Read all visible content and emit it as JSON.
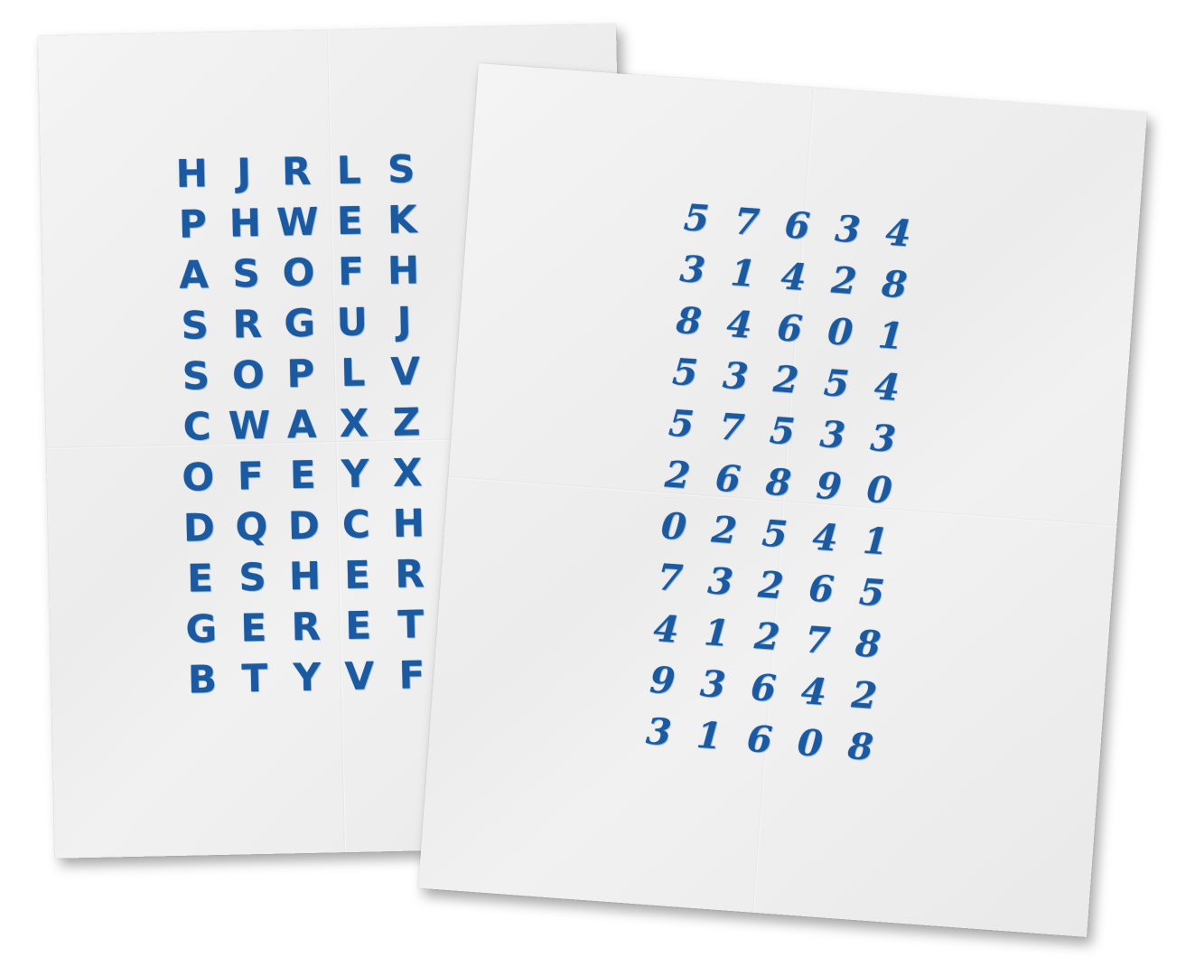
{
  "left_sheet": {
    "rows": [
      [
        "H",
        "J",
        "R",
        "L",
        "S"
      ],
      [
        "P",
        "H",
        "W",
        "E",
        "K"
      ],
      [
        "A",
        "S",
        "O",
        "F",
        "H"
      ],
      [
        "S",
        "R",
        "G",
        "U",
        "J"
      ],
      [
        "S",
        "O",
        "P",
        "L",
        "V"
      ],
      [
        "C",
        "W",
        "A",
        "X",
        "Z"
      ],
      [
        "O",
        "F",
        "E",
        "Y",
        "X"
      ],
      [
        "D",
        "Q",
        "D",
        "C",
        "H"
      ],
      [
        "E",
        "S",
        "H",
        "E",
        "R"
      ],
      [
        "G",
        "E",
        "R",
        "E",
        "T"
      ],
      [
        "B",
        "T",
        "Y",
        "V",
        "F"
      ]
    ]
  },
  "right_sheet": {
    "rows": [
      [
        "5",
        "7",
        "6",
        "3",
        "4"
      ],
      [
        "3",
        "1",
        "4",
        "2",
        "8"
      ],
      [
        "8",
        "4",
        "6",
        "0",
        "1"
      ],
      [
        "5",
        "3",
        "2",
        "5",
        "4"
      ],
      [
        "5",
        "7",
        "5",
        "3",
        "3"
      ],
      [
        "2",
        "6",
        "8",
        "9",
        "0"
      ],
      [
        "0",
        "2",
        "5",
        "4",
        "1"
      ],
      [
        "7",
        "3",
        "2",
        "6",
        "5"
      ],
      [
        "4",
        "1",
        "2",
        "7",
        "8"
      ],
      [
        "9",
        "3",
        "6",
        "4",
        "2"
      ],
      [
        "3",
        "1",
        "6",
        "0",
        "8"
      ]
    ]
  },
  "ink_color": "#1b5aa0"
}
